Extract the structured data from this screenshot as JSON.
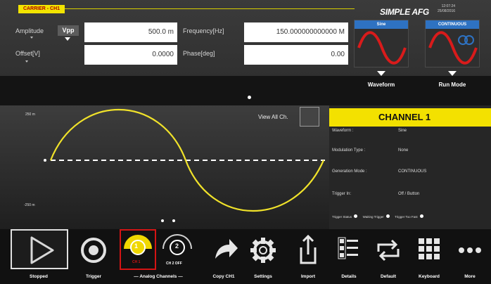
{
  "header": {
    "carrier_label": "CARRIER - CH1",
    "brand": "SIMPLE AFG",
    "datetime_line1": "12:07:24",
    "datetime_line2": "25/08/2016"
  },
  "params": {
    "amplitude_label": "Amplitude",
    "amplitude_unit": "Vpp",
    "amplitude_value": "500.0 m",
    "offset_label": "Offset[V]",
    "offset_value": "0.0000",
    "frequency_label": "Frequency[Hz]",
    "frequency_value": "150.000000000000 M",
    "phase_label": "Phase[deg]",
    "phase_value": "0.00"
  },
  "selectors": {
    "waveform_tile_title": "Sine",
    "waveform_label": "Waveform",
    "runmode_tile_title": "CONTINUOUS",
    "runmode_label": "Run Mode"
  },
  "scope": {
    "top_label": "250 m",
    "bottom_label": "-250 m",
    "zero_marker": "0",
    "view_all_label": "View All Ch."
  },
  "channel": {
    "title": "CHANNEL 1",
    "rows": [
      {
        "key": "Waveform :",
        "value": "Sine"
      },
      {
        "key": "Modulation Type :",
        "value": "None"
      },
      {
        "key": "Generation Mode :",
        "value": "CONTINUOUS"
      },
      {
        "key": "Trigger In:",
        "value": "Off   /   Button"
      }
    ],
    "status_trigger": "Trigger Status",
    "status_waiting": "Waiting Trigger",
    "status_fast": "Trigger Too Fast"
  },
  "toolbar": {
    "stopped": "Stopped",
    "trigger": "Trigger",
    "ch1_number": "1",
    "ch1_state": "CH 1",
    "ch2_number": "2",
    "ch2_state": "CH 2 OFF",
    "analog_channels": "— Analog Channels —",
    "copy": "Copy CH1",
    "settings": "Settings",
    "import": "Import",
    "details": "Details",
    "default": "Default",
    "keyboard": "Keyboard",
    "more": "More"
  },
  "colors": {
    "accent_yellow": "#f3e100",
    "wave_red": "#d91b1b",
    "tile_blue": "#2e72c2",
    "selected_red": "#d41414"
  }
}
